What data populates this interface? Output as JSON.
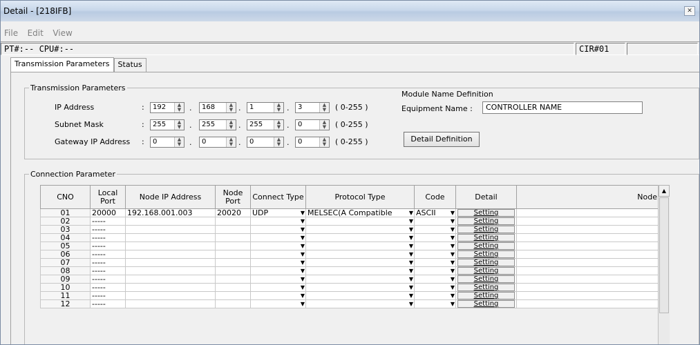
{
  "window": {
    "title": "Detail - [218IFB]",
    "close_glyph": "✕"
  },
  "menu": [
    "File",
    "Edit",
    "View"
  ],
  "info": {
    "pt_cpu": "PT#:-- CPU#:--",
    "cir": "CIR#01"
  },
  "tabs": [
    "Transmission Parameters",
    "Status"
  ],
  "transmission": {
    "legend": "Transmission Parameters",
    "ip_label": "IP Address",
    "subnet_label": "Subnet Mask",
    "gateway_label": "Gateway IP Address",
    "colon": ":",
    "ip": [
      "192",
      "168",
      "1",
      "3"
    ],
    "subnet": [
      "255",
      "255",
      "255",
      "0"
    ],
    "gateway": [
      "0",
      "0",
      "0",
      "0"
    ],
    "range": "( 0-255 )"
  },
  "module": {
    "heading": "Module Name Definition",
    "equipment_label": "Equipment  Name  :",
    "equipment_value": "CONTROLLER NAME",
    "detail_button": "Detail Definition"
  },
  "connection": {
    "legend": "Connection Parameter",
    "headers": {
      "cno": "CNO",
      "local_port": "Local Port",
      "node_ip": "Node IP Address",
      "node_port": "Node Port",
      "connect_type": "Connect Type",
      "protocol_type": "Protocol Type",
      "code": "Code",
      "detail": "Detail",
      "node": "Node"
    },
    "rows": [
      {
        "cno": "01",
        "local_port": "20000",
        "node_ip": "192.168.001.003",
        "node_port": "20020",
        "connect_type": "UDP",
        "protocol_type": "MELSEC(A Compatible",
        "code": "ASCII",
        "detail": "Setting"
      },
      {
        "cno": "02",
        "local_port": "-----",
        "node_ip": "",
        "node_port": "",
        "connect_type": "",
        "protocol_type": "",
        "code": "",
        "detail": "Setting"
      },
      {
        "cno": "03",
        "local_port": "-----",
        "node_ip": "",
        "node_port": "",
        "connect_type": "",
        "protocol_type": "",
        "code": "",
        "detail": "Setting"
      },
      {
        "cno": "04",
        "local_port": "-----",
        "node_ip": "",
        "node_port": "",
        "connect_type": "",
        "protocol_type": "",
        "code": "",
        "detail": "Setting"
      },
      {
        "cno": "05",
        "local_port": "-----",
        "node_ip": "",
        "node_port": "",
        "connect_type": "",
        "protocol_type": "",
        "code": "",
        "detail": "Setting"
      },
      {
        "cno": "06",
        "local_port": "-----",
        "node_ip": "",
        "node_port": "",
        "connect_type": "",
        "protocol_type": "",
        "code": "",
        "detail": "Setting"
      },
      {
        "cno": "07",
        "local_port": "-----",
        "node_ip": "",
        "node_port": "",
        "connect_type": "",
        "protocol_type": "",
        "code": "",
        "detail": "Setting"
      },
      {
        "cno": "08",
        "local_port": "-----",
        "node_ip": "",
        "node_port": "",
        "connect_type": "",
        "protocol_type": "",
        "code": "",
        "detail": "Setting"
      },
      {
        "cno": "09",
        "local_port": "-----",
        "node_ip": "",
        "node_port": "",
        "connect_type": "",
        "protocol_type": "",
        "code": "",
        "detail": "Setting"
      },
      {
        "cno": "10",
        "local_port": "-----",
        "node_ip": "",
        "node_port": "",
        "connect_type": "",
        "protocol_type": "",
        "code": "",
        "detail": "Setting"
      },
      {
        "cno": "11",
        "local_port": "-----",
        "node_ip": "",
        "node_port": "",
        "connect_type": "",
        "protocol_type": "",
        "code": "",
        "detail": "Setting"
      },
      {
        "cno": "12",
        "local_port": "-----",
        "node_ip": "",
        "node_port": "",
        "connect_type": "",
        "protocol_type": "",
        "code": "",
        "detail": "Setting"
      }
    ]
  }
}
